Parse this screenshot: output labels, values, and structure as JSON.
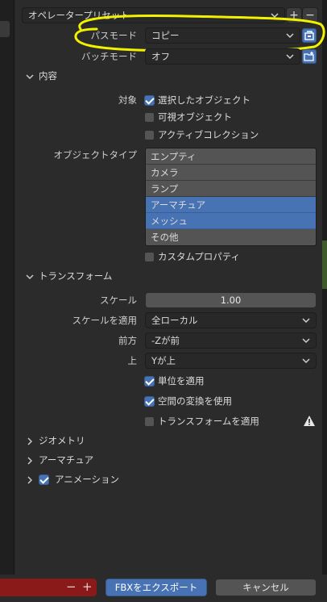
{
  "preset": {
    "label": "オペレータープリセット",
    "add": "+",
    "remove": "−"
  },
  "path_mode": {
    "label": "パスモード",
    "value": "コピー"
  },
  "batch_mode": {
    "label": "バッチモード",
    "value": "オフ"
  },
  "include": {
    "title": "内容",
    "target_label": "対象",
    "checks": [
      {
        "label": "選択したオブジェクト",
        "checked": true
      },
      {
        "label": "可視オブジェクト",
        "checked": false
      },
      {
        "label": "アクティブコレクション",
        "checked": false
      }
    ],
    "object_types_label": "オブジェクトタイプ",
    "object_types": [
      {
        "label": "エンプティ",
        "selected": false
      },
      {
        "label": "カメラ",
        "selected": false
      },
      {
        "label": "ランプ",
        "selected": false
      },
      {
        "label": "アーマチュア",
        "selected": true
      },
      {
        "label": "メッシュ",
        "selected": true
      },
      {
        "label": "その他",
        "selected": false
      }
    ],
    "custom_props": {
      "label": "カスタムプロパティ",
      "checked": false
    }
  },
  "transform": {
    "title": "トランスフォーム",
    "scale_label": "スケール",
    "scale_value": "1.00",
    "apply_scale_label": "スケールを適用",
    "apply_scale_value": "全ローカル",
    "forward_label": "前方",
    "forward_value": "-Zが前",
    "up_label": "上",
    "up_value": "Yが上",
    "apply_unit": {
      "label": "単位を適用",
      "checked": true
    },
    "space_transform": {
      "label": "空間の変換を使用",
      "checked": true
    },
    "apply_transform": {
      "label": "トランスフォームを適用",
      "checked": false
    }
  },
  "collapsed_sections": {
    "geometry": "ジオメトリ",
    "armature": "アーマチュア",
    "animation": "アニメーション"
  },
  "footer": {
    "minus": "−",
    "plus": "+",
    "export": "FBXをエクスポート",
    "cancel": "キャンセル"
  },
  "colors": {
    "accent": "#4772b3",
    "annotation": "#f2f200",
    "danger_bar": "#8a1a1a"
  }
}
